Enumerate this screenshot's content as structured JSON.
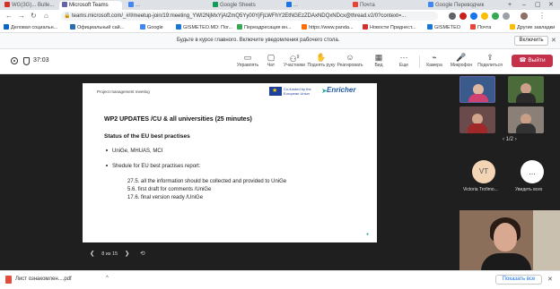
{
  "browser": {
    "tabs": [
      {
        "label": "WG(3G)... Bulle...",
        "active": false
      },
      {
        "label": "Microsoft Teams",
        "active": true
      },
      {
        "label": "...",
        "active": false
      },
      {
        "label": "Google Sheets",
        "active": false
      },
      {
        "label": "...",
        "active": false
      },
      {
        "label": "Почта",
        "active": false
      },
      {
        "label": "Google Переводчик",
        "active": false
      }
    ],
    "url": "teams.microsoft.com/_#/l/meetup-join/19:meeting_YWI2NjMxYjAtZmQ5Yy00YjFjLWFhY2EtNGEzZDAxNDQxNDcx@thread.v2/0?context=...",
    "bookmarks": [
      "Деловая социальн...",
      "Официальный сай...",
      "Google",
      "GISMETEO.MD: Пог...",
      "Переадресация вн...",
      "https://www.panda...",
      "Новости Приднест...",
      "GISMETEO",
      "Почта",
      "Другие закладки"
    ],
    "notification": {
      "text": "Будьте в курсе главного. Включите уведомления рабочего стола.",
      "button": "Включить"
    }
  },
  "meeting": {
    "timer": "37:03",
    "toolbar": [
      {
        "label": "Управлять",
        "icon": "screen-share-icon"
      },
      {
        "label": "Чат",
        "icon": "chat-icon"
      },
      {
        "label": "Участники",
        "icon": "participants-icon",
        "badge": "9"
      },
      {
        "label": "Поднять руку",
        "icon": "hand-icon"
      },
      {
        "label": "Реагировать",
        "icon": "smile-icon"
      },
      {
        "label": "Вид",
        "icon": "grid-icon"
      },
      {
        "label": "Еще",
        "icon": "more-icon"
      },
      {
        "label": "Камера",
        "icon": "camera-icon"
      },
      {
        "label": "Микрофон",
        "icon": "mic-icon"
      },
      {
        "label": "Поделиться",
        "icon": "share-icon"
      }
    ],
    "leave_label": "Выйти"
  },
  "slide": {
    "header": "Project management meeting",
    "eu_text": "Co-funded by the European Union",
    "logo": "Enricher",
    "title": "WP2 UPDATES /CU & all universities (25 minutes)",
    "subtitle": "Status of the EU best practises",
    "bullets": [
      "UniGe, MHUAS, MCI",
      "Shedule for EU best practises report:"
    ],
    "sublines": [
      "27.5. all the information should be collected and provided to UniGe",
      "5.6. first draft for comments /UniGe",
      "17.6. final version ready /UniGe"
    ],
    "pager": "8 из 15"
  },
  "participants": {
    "page": "1/2",
    "avatar_initials": "VT",
    "avatar_name": "Victoria Trofimo...",
    "more_label": "Увидеть всех",
    "more_icon": "..."
  },
  "downloads": {
    "file": "Лист ознакомлен....pdf",
    "show_all": "Показать все"
  }
}
